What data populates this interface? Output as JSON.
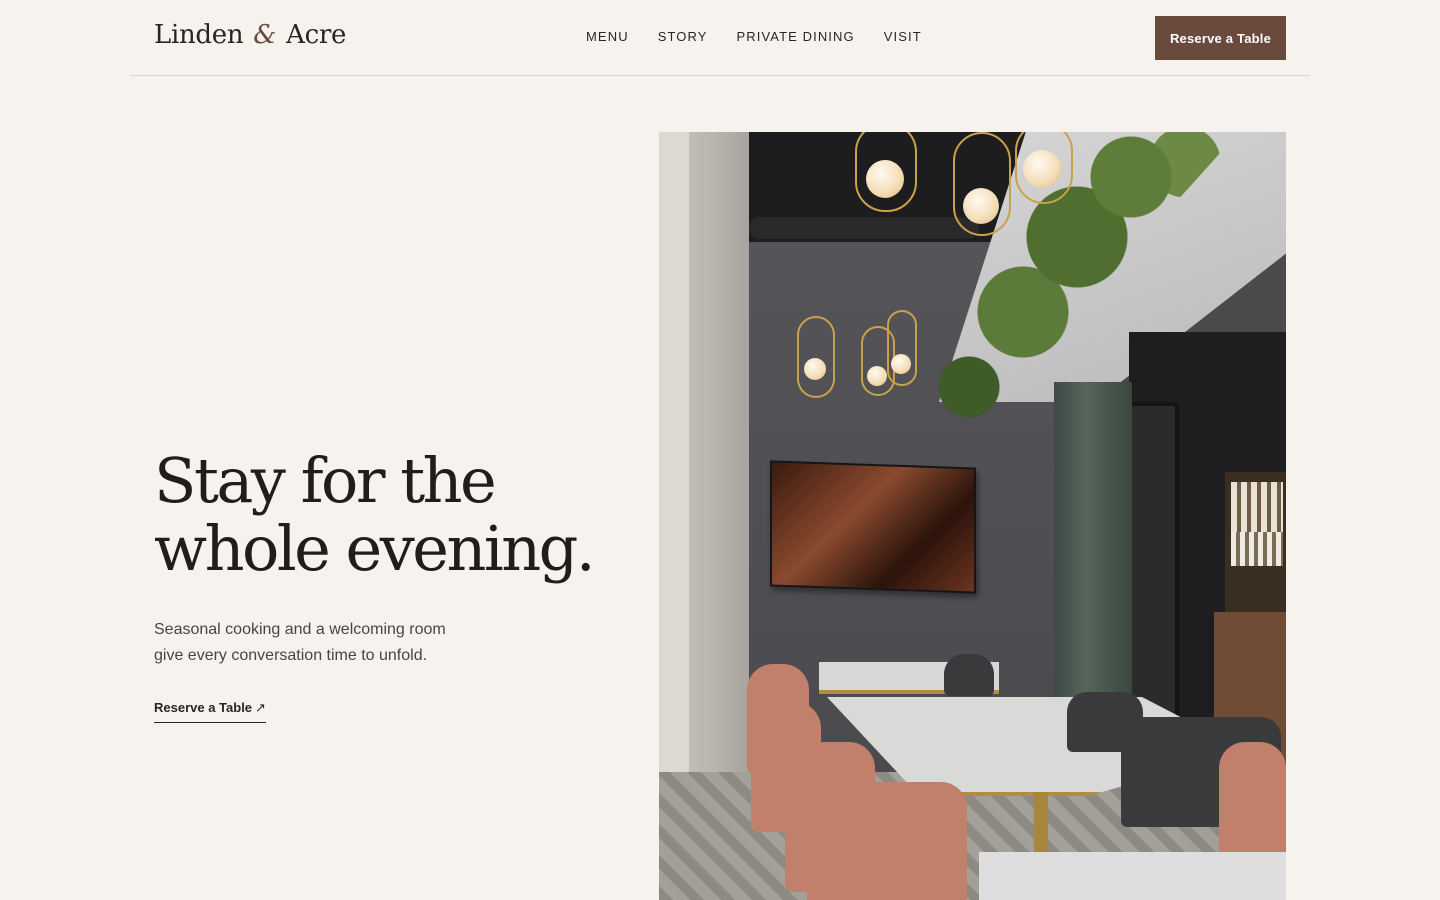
{
  "brand": {
    "name_part1": "Linden",
    "ampersand": "&",
    "name_part2": "Acre",
    "accent_color": "#6b4a3e"
  },
  "nav": {
    "items": [
      "MENU",
      "STORY",
      "PRIVATE DINING",
      "VISIT"
    ]
  },
  "header": {
    "cta_label": "Reserve a Table"
  },
  "hero": {
    "headline_line1": "Stay for the",
    "headline_line2": "whole evening.",
    "lede_line1": "Seasonal cooking and a welcoming room",
    "lede_line2": "give every conversation time to unfold.",
    "link_label": "Reserve a Table",
    "link_arrow": "↗"
  },
  "colors": {
    "background": "#f6f3ee",
    "text": "#2a2522",
    "button": "#6b4a3e"
  }
}
